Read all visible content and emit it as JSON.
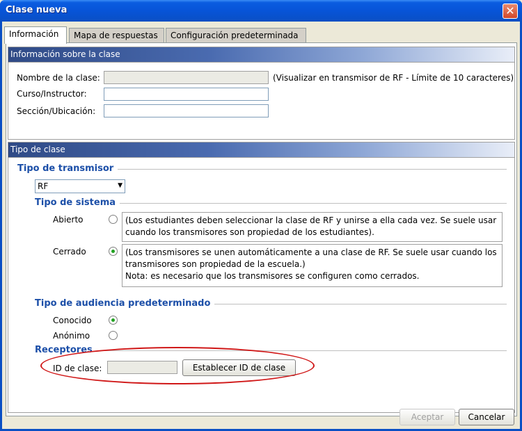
{
  "window": {
    "title": "Clase nueva",
    "close": "✕"
  },
  "tabs": [
    {
      "label": "Información",
      "active": true
    },
    {
      "label": "Mapa de respuestas",
      "active": false
    },
    {
      "label": "Configuración predeterminada",
      "active": false
    }
  ],
  "info_section": {
    "header": "Información sobre la clase",
    "class_name": {
      "label": "Nombre de la clase:",
      "value": "",
      "hint": "(Visualizar en transmisor de RF - Límite de 10 caracteres)"
    },
    "course": {
      "label": "Curso/Instructor:",
      "value": ""
    },
    "section": {
      "label": "Sección/Ubicación:",
      "value": ""
    }
  },
  "type_section": {
    "header": "Tipo de clase",
    "transmitter_type": {
      "title": "Tipo de transmisor",
      "selected": "RF"
    },
    "system_type": {
      "title": "Tipo de sistema",
      "open": {
        "label": "Abierto",
        "checked": false,
        "desc_line1": "(Los estudiantes deben seleccionar la clase de RF y unirse a ella cada vez. Se suele usar",
        "desc_line2": "cuando los transmisores son propiedad de los estudiantes)."
      },
      "closed": {
        "label": "Cerrado",
        "checked": true,
        "desc_line1": "(Los transmisores se unen automáticamente a una clase de RF. Se suele usar cuando los",
        "desc_line2": "transmisores son propiedad de la escuela.)",
        "desc_line3": "Nota: es necesario que los transmisores se configuren como cerrados."
      }
    },
    "audience_type": {
      "title": "Tipo de audiencia predeterminado",
      "known": {
        "label": "Conocido",
        "checked": true
      },
      "anonymous": {
        "label": "Anónimo",
        "checked": false
      }
    },
    "receivers": {
      "title": "Receptores",
      "class_id_label": "ID de clase:",
      "class_id_value": "",
      "set_button": "Establecer ID de clase"
    }
  },
  "footer": {
    "accept": "Aceptar",
    "cancel": "Cancelar"
  }
}
